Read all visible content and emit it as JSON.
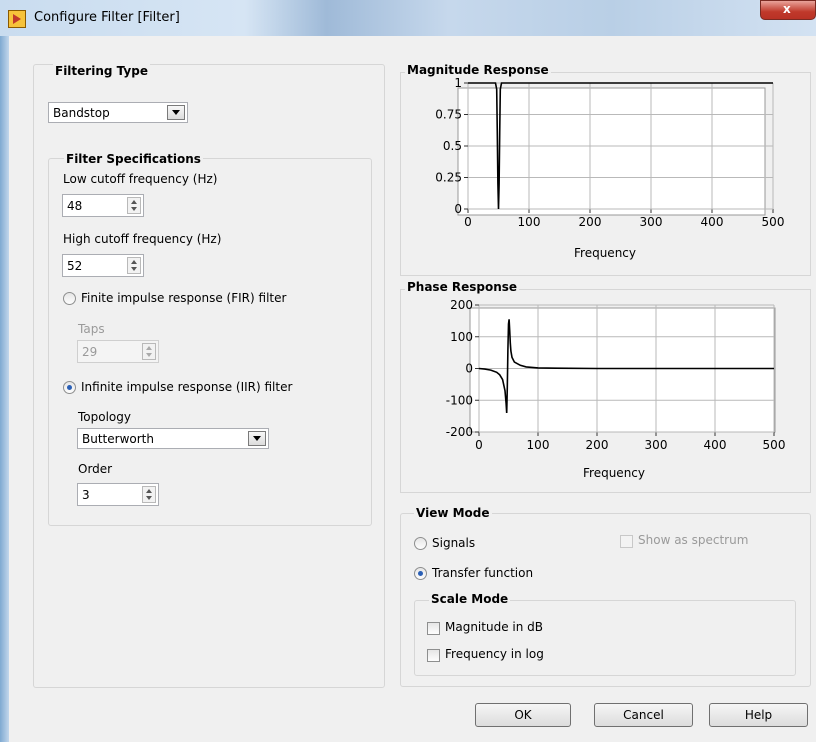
{
  "window": {
    "title": "Configure Filter [Filter]",
    "close_label": "x"
  },
  "filtering_type": {
    "title": "Filtering Type",
    "selected": "Bandstop"
  },
  "filter_specs": {
    "title": "Filter Specifications",
    "low_cutoff": {
      "label": "Low cutoff frequency (Hz)",
      "value": "48"
    },
    "high_cutoff": {
      "label": "High cutoff frequency (Hz)",
      "value": "52"
    },
    "fir": {
      "label": "Finite impulse response (FIR) filter",
      "selected": false
    },
    "taps": {
      "label": "Taps",
      "value": "29"
    },
    "iir": {
      "label": "Infinite impulse response (IIR) filter",
      "selected": true
    },
    "topology": {
      "label": "Topology",
      "selected": "Butterworth"
    },
    "order": {
      "label": "Order",
      "value": "3"
    }
  },
  "magnitude": {
    "title": "Magnitude Response",
    "x_tick_labels": [
      "0",
      "100",
      "200",
      "300",
      "400",
      "500"
    ],
    "y_tick_labels": [
      "0",
      "0.25",
      "0.5",
      "0.75",
      "1"
    ],
    "xlabel": "Frequency"
  },
  "phase": {
    "title": "Phase Response",
    "x_tick_labels": [
      "0",
      "100",
      "200",
      "300",
      "400",
      "500"
    ],
    "y_tick_labels": [
      "-200",
      "-100",
      "0",
      "100",
      "200"
    ],
    "xlabel": "Frequency"
  },
  "view_mode": {
    "title": "View Mode",
    "signals": {
      "label": "Signals",
      "selected": false
    },
    "transfer": {
      "label": "Transfer function",
      "selected": true
    },
    "spectrum": {
      "label": "Show as spectrum",
      "checked": false,
      "enabled": false
    }
  },
  "scale_mode": {
    "title": "Scale Mode",
    "mag_db": {
      "label": "Magnitude in dB",
      "checked": false
    },
    "freq_log": {
      "label": "Frequency in log",
      "checked": false
    }
  },
  "buttons": {
    "ok": "OK",
    "cancel": "Cancel",
    "help": "Help"
  },
  "chart_data": [
    {
      "type": "line",
      "title": "Magnitude Response",
      "xlabel": "Frequency",
      "ylabel": "",
      "xlim": [
        0,
        500
      ],
      "ylim": [
        0,
        1
      ],
      "grid": true,
      "x": [
        0,
        45,
        47,
        48,
        49,
        50,
        51,
        52,
        53,
        55,
        100,
        200,
        300,
        400,
        500
      ],
      "y": [
        1,
        1,
        0.95,
        0.6,
        0.2,
        0,
        0.2,
        0.6,
        0.95,
        1,
        1,
        1,
        1,
        1,
        1
      ]
    },
    {
      "type": "line",
      "title": "Phase Response",
      "xlabel": "Frequency",
      "ylabel": "",
      "xlim": [
        0,
        500
      ],
      "ylim": [
        -200,
        200
      ],
      "grid": true,
      "x": [
        0,
        10,
        20,
        30,
        35,
        40,
        44,
        46,
        47,
        48,
        49,
        50,
        51,
        52,
        53,
        54,
        56,
        60,
        70,
        80,
        100,
        130,
        200,
        300,
        400,
        500
      ],
      "y": [
        0,
        -2,
        -5,
        -12,
        -20,
        -35,
        -70,
        -110,
        -140,
        -60,
        60,
        140,
        155,
        120,
        80,
        55,
        35,
        20,
        10,
        5,
        2,
        1,
        0,
        0,
        0,
        0
      ]
    }
  ]
}
